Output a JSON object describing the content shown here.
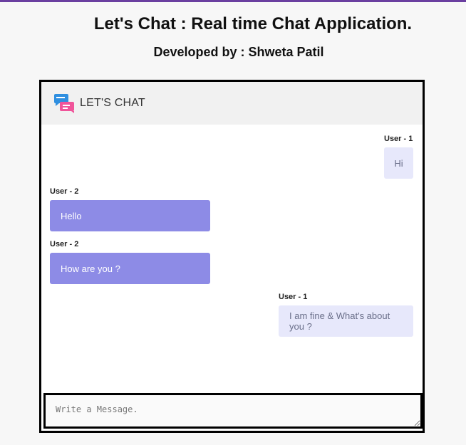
{
  "page": {
    "title": "Let's Chat : Real time Chat Application.",
    "subtitle": "Developed by : Shweta Patil"
  },
  "chat": {
    "header_title": "LET'S CHAT",
    "logo_icon": "chat-bubbles-icon",
    "messages": [
      {
        "sender": "User - 1",
        "text": "Hi",
        "side": "right"
      },
      {
        "sender": "User - 2",
        "text": "Hello",
        "side": "left"
      },
      {
        "sender": "User - 2",
        "text": "How are you ?",
        "side": "left"
      },
      {
        "sender": "User - 1",
        "text": "I am fine & What's about you ?",
        "side": "right"
      }
    ],
    "input": {
      "placeholder": "Write a Message.",
      "value": ""
    }
  },
  "colors": {
    "accent_bar": "#6a3fa0",
    "own_bubble": "#e7e8fb",
    "other_bubble": "#8d8be6"
  }
}
